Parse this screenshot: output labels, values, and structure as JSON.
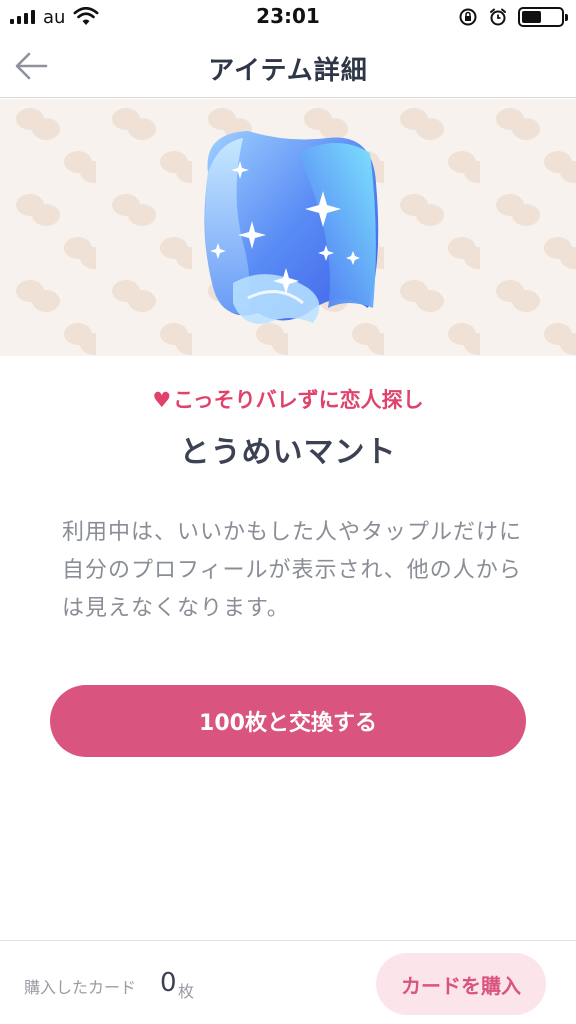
{
  "status_bar": {
    "carrier": "au",
    "time": "23:01",
    "signal_bars": 4,
    "battery_level": 0.5,
    "icons": [
      "signal-icon",
      "wifi-icon",
      "rotation-lock-icon",
      "alarm-icon",
      "battery-icon"
    ]
  },
  "nav": {
    "title": "アイテム詳細",
    "back_icon": "back-arrow-icon"
  },
  "item": {
    "image": "invisible-cape-icon",
    "category": "こっそりバレずに恋人探し",
    "category_icon": "heart-icon",
    "name": "とうめいマント",
    "description": "利用中は、いいかもした人やタップルだけに自分のプロフィールが表示され、他の人からは見えなくなります。"
  },
  "actions": {
    "exchange_label": "100枚と交換する"
  },
  "footer": {
    "purchased_label": "購入したカード",
    "purchased_count": "0",
    "purchased_unit": "枚",
    "buy_label": "カードを購入"
  },
  "colors": {
    "accent": "#d9557f",
    "category": "#e0426c",
    "hero_background": "#f7f2ee",
    "buy_button_background": "#fbe4ea"
  }
}
